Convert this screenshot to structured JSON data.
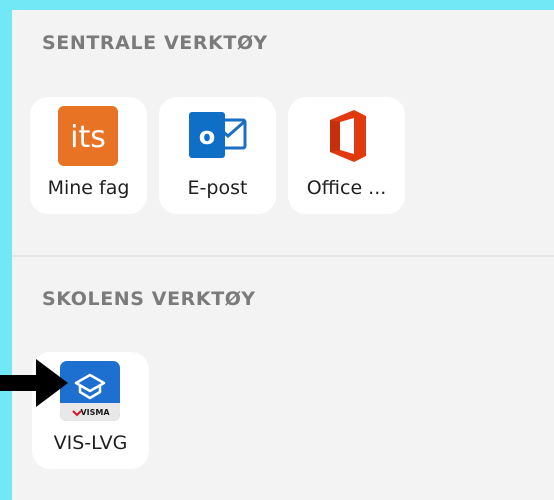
{
  "sections": {
    "central": {
      "title": "SENTRALE VERKTØY",
      "tiles": [
        {
          "label": "Mine fag",
          "icon": "its-learning-icon",
          "color": "#e97324",
          "icon_text": "its"
        },
        {
          "label": "E-post",
          "icon": "outlook-icon",
          "color": "#0f6fc6",
          "icon_text": "o"
        },
        {
          "label": "Office ...",
          "icon": "office-icon",
          "color": "#e23a10"
        }
      ]
    },
    "school": {
      "title": "SKOLENS VERKTØY",
      "tiles": [
        {
          "label": "VIS-LVG",
          "icon": "visma-icon",
          "color": "#1d6fd0",
          "brand_text": "VISMA"
        }
      ]
    }
  },
  "colors": {
    "background": "#72e8f7",
    "panel": "#f3f3f3",
    "tile": "#ffffff",
    "section_title": "#7b7b7b"
  },
  "annotation": {
    "icon": "arrow-right-icon"
  }
}
